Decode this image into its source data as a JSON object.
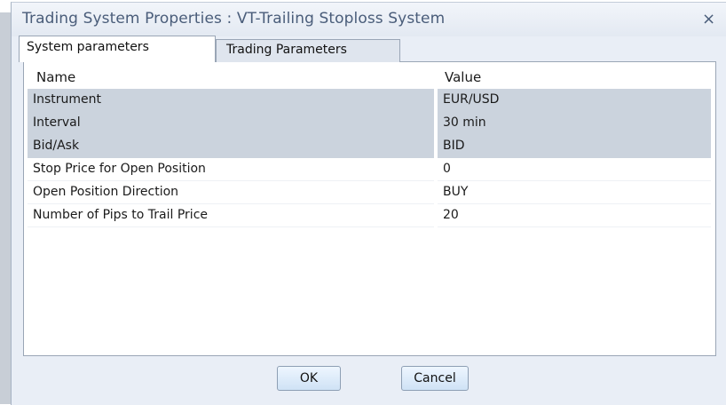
{
  "window": {
    "title": "Trading System Properties : VT-Trailing Stoploss System",
    "close_label": "×"
  },
  "tabs": [
    {
      "label": "System parameters",
      "active": true
    },
    {
      "label": "Trading Parameters",
      "active": false
    }
  ],
  "grid": {
    "headers": {
      "name": "Name",
      "value": "Value"
    },
    "rows": [
      {
        "name": "Instrument",
        "value": "EUR/USD",
        "shaded": true
      },
      {
        "name": "Interval",
        "value": "30 min",
        "shaded": true
      },
      {
        "name": "Bid/Ask",
        "value": "BID",
        "shaded": true
      },
      {
        "name": "Stop Price for Open Position",
        "value": "0",
        "shaded": false
      },
      {
        "name": "Open Position Direction",
        "value": "BUY",
        "shaded": false,
        "has_dropdown": true
      },
      {
        "name": "Number of Pips to Trail Price",
        "value": "20",
        "shaded": false
      }
    ]
  },
  "buttons": {
    "ok": "OK",
    "cancel": "Cancel"
  },
  "icons": {
    "close": "close-icon",
    "dropdown": "chevron-down-icon"
  },
  "colors": {
    "title_text": "#4a5d7a",
    "shaded_row": "#cbd3dd",
    "dialog_bg": "#e9eef6"
  }
}
